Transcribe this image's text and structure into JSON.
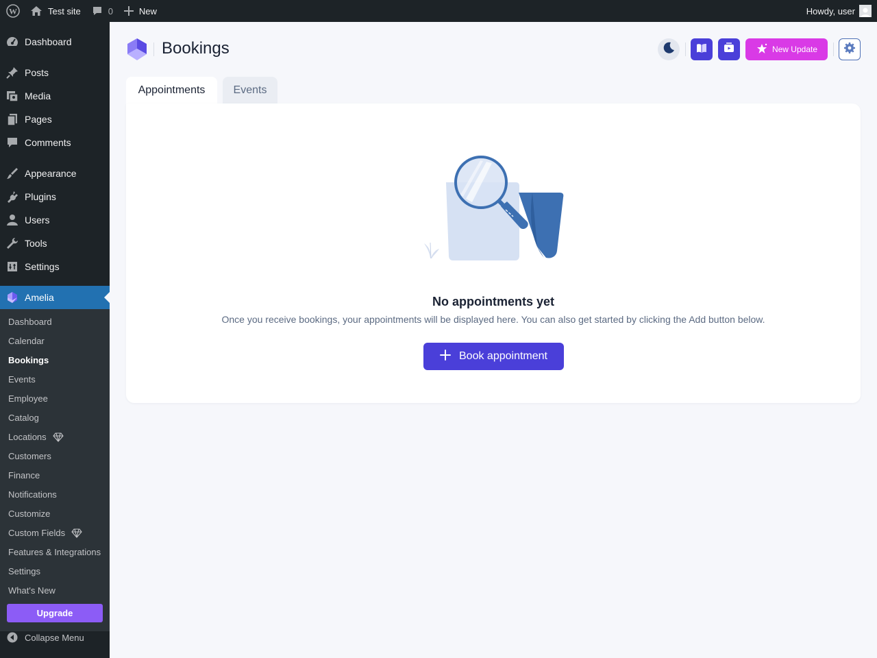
{
  "adminbar": {
    "site_name": "Test site",
    "comments_count": "0",
    "new_label": "New",
    "howdy": "Howdy, user"
  },
  "sidebar": {
    "items": [
      {
        "label": "Dashboard",
        "icon": "dashboard-icon"
      },
      {
        "label": "Posts",
        "icon": "pin-icon"
      },
      {
        "label": "Media",
        "icon": "media-icon"
      },
      {
        "label": "Pages",
        "icon": "pages-icon"
      },
      {
        "label": "Comments",
        "icon": "comment-icon"
      },
      {
        "label": "Appearance",
        "icon": "brush-icon"
      },
      {
        "label": "Plugins",
        "icon": "plug-icon"
      },
      {
        "label": "Users",
        "icon": "user-icon"
      },
      {
        "label": "Tools",
        "icon": "wrench-icon"
      },
      {
        "label": "Settings",
        "icon": "settings-icon"
      },
      {
        "label": "Amelia",
        "icon": "amelia-icon"
      }
    ],
    "submenu": [
      {
        "label": "Dashboard"
      },
      {
        "label": "Calendar"
      },
      {
        "label": "Bookings"
      },
      {
        "label": "Events"
      },
      {
        "label": "Employee"
      },
      {
        "label": "Catalog"
      },
      {
        "label": "Locations"
      },
      {
        "label": "Customers"
      },
      {
        "label": "Finance"
      },
      {
        "label": "Notifications"
      },
      {
        "label": "Customize"
      },
      {
        "label": "Custom Fields"
      },
      {
        "label": "Features & Integrations"
      },
      {
        "label": "Settings"
      },
      {
        "label": "What's New"
      }
    ],
    "upgrade_label": "Upgrade",
    "collapse_label": "Collapse Menu"
  },
  "header": {
    "title": "Bookings",
    "new_update_label": "New Update"
  },
  "tabs": [
    {
      "label": "Appointments",
      "active": true
    },
    {
      "label": "Events",
      "active": false
    }
  ],
  "empty_state": {
    "title": "No appointments yet",
    "description": "Once you receive bookings, your appointments will be displayed here. You can also get started by clicking the Add button below.",
    "button_label": "Book appointment"
  },
  "colors": {
    "primary": "#4a3fd9",
    "update": "#d93ae6",
    "wp_active": "#2271b1",
    "upgrade": "#8c5cf6"
  }
}
